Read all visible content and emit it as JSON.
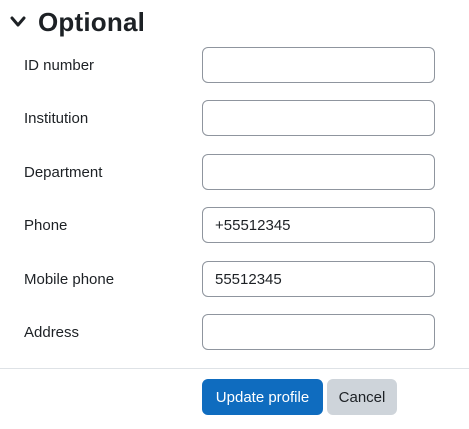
{
  "section": {
    "title": "Optional",
    "expanded": true,
    "toggle_icon": "chevron-down-icon"
  },
  "fields": [
    {
      "label": "ID number",
      "value": ""
    },
    {
      "label": "Institution",
      "value": ""
    },
    {
      "label": "Department",
      "value": ""
    },
    {
      "label": "Phone",
      "value": "+55512345"
    },
    {
      "label": "Mobile phone",
      "value": "55512345"
    },
    {
      "label": "Address",
      "value": ""
    }
  ],
  "actions": {
    "submit_label": "Update profile",
    "cancel_label": "Cancel"
  },
  "colors": {
    "primary": "#0f6cbf",
    "secondary": "#ced4da",
    "text": "#1d2125",
    "input_border": "#8f959e"
  }
}
